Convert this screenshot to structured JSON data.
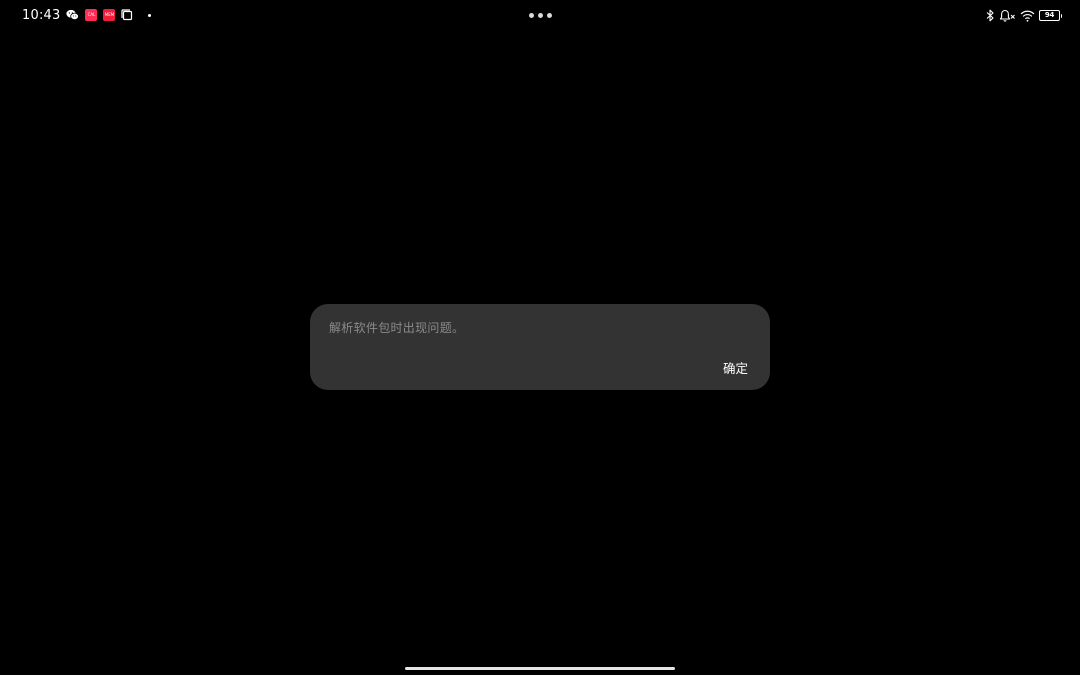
{
  "status_bar": {
    "time": "10:43",
    "left_icons": [
      "wechat-icon",
      "app-badge-icon",
      "app-badge-icon",
      "multiwindow-icon",
      "notification-dot"
    ],
    "app_badge_1_text": "CAL",
    "app_badge_2_text": "MEM",
    "right_icons": [
      "bluetooth-icon",
      "bell-mute-icon",
      "wifi-icon",
      "battery-icon"
    ],
    "battery_level": "94"
  },
  "dialog": {
    "message": "解析软件包时出现问题。",
    "confirm_label": "确定"
  },
  "colors": {
    "background": "#000000",
    "dialog_bg": "#333333",
    "message_text": "#8a8a8a",
    "button_text": "#ffffff",
    "app_badge": "#ff2d55"
  }
}
